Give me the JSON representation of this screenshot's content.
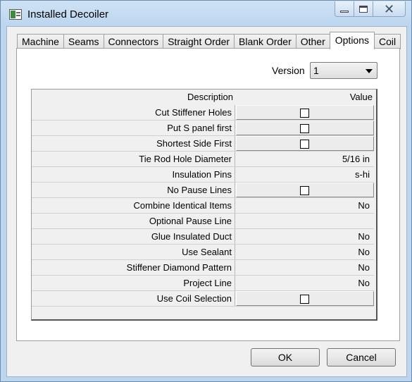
{
  "window": {
    "title": "Installed Decoiler"
  },
  "tabs": [
    "Machine",
    "Seams",
    "Connectors",
    "Straight Order",
    "Blank Order",
    "Other",
    "Options",
    "Coil"
  ],
  "active_tab": "Options",
  "version": {
    "label": "Version",
    "selected": "1"
  },
  "grid": {
    "headers": {
      "description": "Description",
      "value": "Value"
    },
    "rows": [
      {
        "label": "Cut Stiffener Holes",
        "type": "checkbox",
        "checked": false,
        "value": ""
      },
      {
        "label": "Put S panel first",
        "type": "checkbox",
        "checked": false,
        "value": ""
      },
      {
        "label": "Shortest Side First",
        "type": "checkbox",
        "checked": false,
        "value": ""
      },
      {
        "label": "Tie Rod Hole Diameter",
        "type": "text",
        "value": "5/16 in"
      },
      {
        "label": "Insulation Pins",
        "type": "text",
        "value": "s-hi"
      },
      {
        "label": "No Pause Lines",
        "type": "checkbox",
        "checked": false,
        "value": ""
      },
      {
        "label": "Combine Identical Items",
        "type": "text",
        "value": "No"
      },
      {
        "label": "Optional Pause Line",
        "type": "text",
        "value": ""
      },
      {
        "label": "Glue Insulated Duct",
        "type": "text",
        "value": "No"
      },
      {
        "label": "Use Sealant",
        "type": "text",
        "value": "No"
      },
      {
        "label": "Stiffener Diamond Pattern",
        "type": "text",
        "value": "No"
      },
      {
        "label": "Project Line",
        "type": "text",
        "value": "No"
      },
      {
        "label": "Use Coil Selection",
        "type": "checkbox",
        "checked": false,
        "value": ""
      }
    ]
  },
  "buttons": {
    "ok": "OK",
    "cancel": "Cancel"
  }
}
